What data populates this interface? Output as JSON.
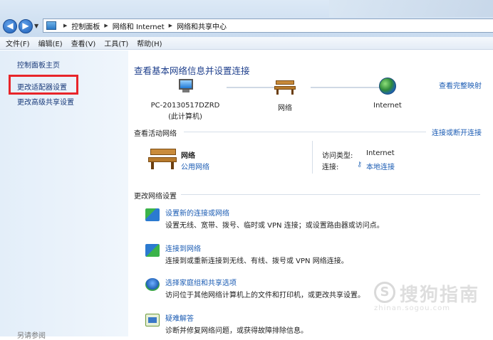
{
  "breadcrumb": {
    "items": [
      "控制面板",
      "网络和 Internet",
      "网络和共享中心"
    ]
  },
  "menu": [
    "文件(F)",
    "编辑(E)",
    "查看(V)",
    "工具(T)",
    "帮助(H)"
  ],
  "sidebar": {
    "home": "控制面板主页",
    "adapter": "更改适配器设置",
    "advanced": "更改高级共享设置",
    "see_also": "另请参阅"
  },
  "main": {
    "heading": "查看基本网络信息并设置连接",
    "full_map": "查看完整映射",
    "nodes": {
      "pc_name": "PC-20130517DZRD",
      "pc_sub": "(此计算机)",
      "network": "网络",
      "internet": "Internet"
    },
    "active": {
      "title": "查看活动网络",
      "connect_link": "连接或断开连接",
      "name": "网络",
      "type": "公用网络",
      "access_label": "访问类型:",
      "access_value": "Internet",
      "conn_label": "连接:",
      "conn_value": "本地连接"
    },
    "settings_title": "更改网络设置",
    "tasks": [
      {
        "link": "设置新的连接或网络",
        "desc": "设置无线、宽带、拨号、临时或 VPN 连接；或设置路由器或访问点。",
        "icon": "network-setup-icon"
      },
      {
        "link": "连接到网络",
        "desc": "连接到或重新连接到无线、有线、拨号或 VPN 网络连接。",
        "icon": "network-connect-icon"
      },
      {
        "link": "选择家庭组和共享选项",
        "desc": "访问位于其他网络计算机上的文件和打印机，或更改共享设置。",
        "icon": "homegroup-icon"
      },
      {
        "link": "疑难解答",
        "desc": "诊断并修复网络问题，或获得故障排除信息。",
        "icon": "troubleshoot-icon"
      }
    ]
  },
  "watermark": {
    "text": "搜狗指南",
    "url": "zhinan.sogou.com"
  }
}
